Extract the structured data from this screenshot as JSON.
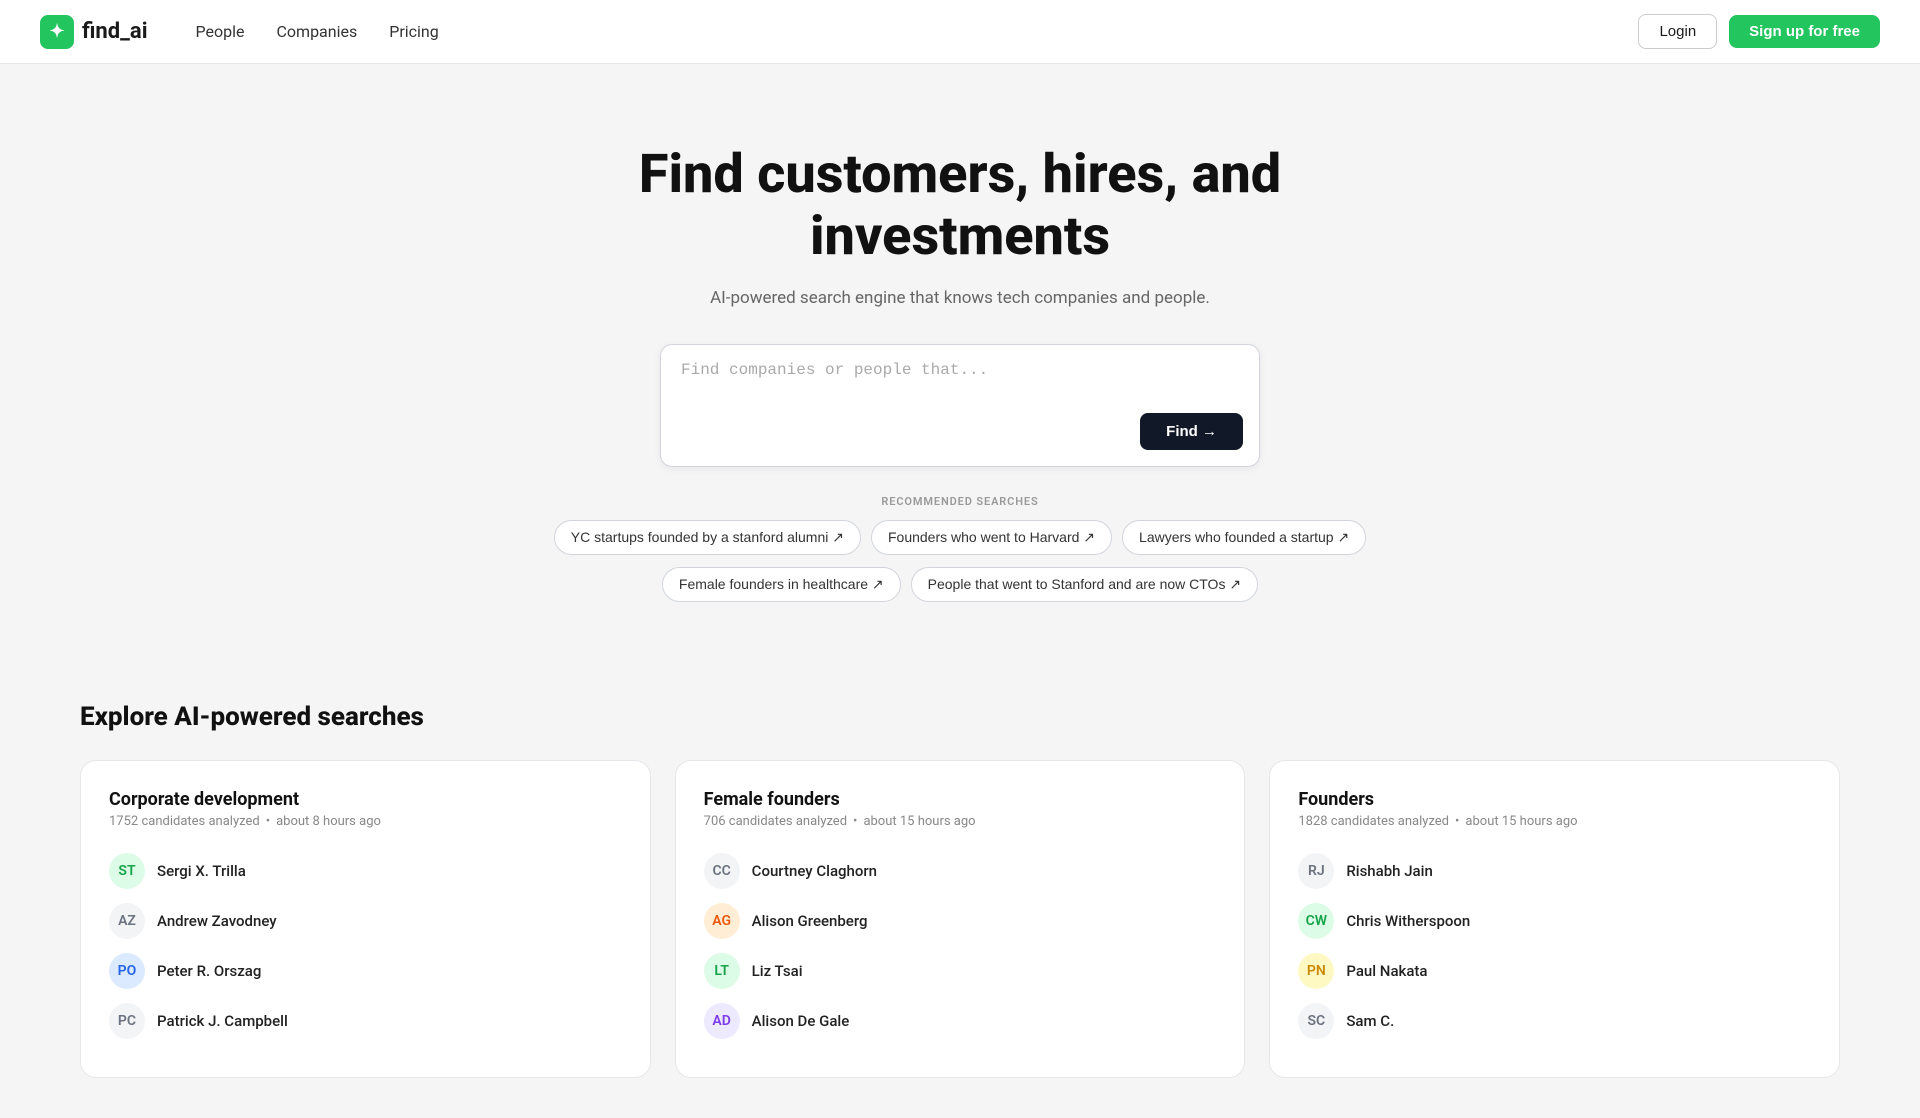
{
  "brand": {
    "logo_symbol": "✦",
    "name": "find_ai"
  },
  "nav": {
    "links": [
      {
        "id": "people",
        "label": "People"
      },
      {
        "id": "companies",
        "label": "Companies"
      },
      {
        "id": "pricing",
        "label": "Pricing"
      }
    ],
    "login_label": "Login",
    "signup_label": "Sign up for free"
  },
  "hero": {
    "heading_line1": "Find customers, hires, and",
    "heading_line2": "investments",
    "subtext": "AI-powered search engine that knows tech companies and people.",
    "search_placeholder": "Find companies or people that...",
    "find_button": "Find →"
  },
  "recommended": {
    "label": "RECOMMENDED SEARCHES",
    "chips": [
      "YC startups founded by a stanford alumni ↗",
      "Founders who went to Harvard ↗",
      "Lawyers who founded a startup ↗",
      "Female founders in healthcare ↗",
      "People that went to Stanford and are now CTOs ↗"
    ]
  },
  "explore": {
    "title": "Explore AI-powered searches",
    "cards": [
      {
        "id": "corporate-development",
        "title": "Corporate development",
        "candidates": "1752 candidates analyzed",
        "time": "about 8 hours ago",
        "people": [
          {
            "name": "Sergi X. Trilla",
            "initials": "ST",
            "color": "av-green"
          },
          {
            "name": "Andrew Zavodney",
            "initials": "AZ",
            "color": "av-gray"
          },
          {
            "name": "Peter R. Orszag",
            "initials": "PO",
            "color": "av-blue"
          },
          {
            "name": "Patrick J. Campbell",
            "initials": "PC",
            "color": "av-gray"
          }
        ]
      },
      {
        "id": "female-founders",
        "title": "Female founders",
        "candidates": "706 candidates analyzed",
        "time": "about 15 hours ago",
        "people": [
          {
            "name": "Courtney Claghorn",
            "initials": "CC",
            "color": "av-gray"
          },
          {
            "name": "Alison Greenberg",
            "initials": "AG",
            "color": "av-orange"
          },
          {
            "name": "Liz Tsai",
            "initials": "LT",
            "color": "av-green"
          },
          {
            "name": "Alison De Gale",
            "initials": "AD",
            "color": "av-purple"
          }
        ]
      },
      {
        "id": "founders",
        "title": "Founders",
        "candidates": "1828 candidates analyzed",
        "time": "about 15 hours ago",
        "people": [
          {
            "name": "Rishabh Jain",
            "initials": "RJ",
            "color": "av-gray"
          },
          {
            "name": "Chris Witherspoon",
            "initials": "CW",
            "color": "av-green"
          },
          {
            "name": "Paul Nakata",
            "initials": "PN",
            "color": "av-yellow"
          },
          {
            "name": "Sam C.",
            "initials": "SC",
            "color": "av-gray"
          }
        ]
      }
    ]
  }
}
